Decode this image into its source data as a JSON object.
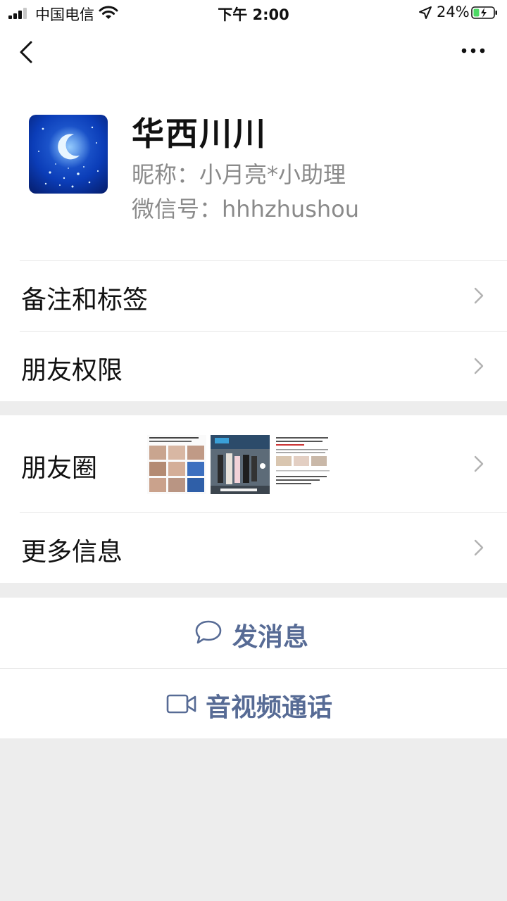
{
  "status_bar": {
    "carrier": "中国电信",
    "time": "下午 2:00",
    "battery": "24%"
  },
  "profile": {
    "name": "华西川川",
    "nickname": "昵称：小月亮*小助理",
    "wechat_id": "微信号：hhhzhushou"
  },
  "rows": {
    "remarks": "备注和标签",
    "permissions": "朋友权限",
    "moments": "朋友圈",
    "more_info": "更多信息"
  },
  "actions": {
    "message": "发消息",
    "call": "音视频通话"
  },
  "colors": {
    "link_blue": "#576b95",
    "background": "#ededed"
  }
}
